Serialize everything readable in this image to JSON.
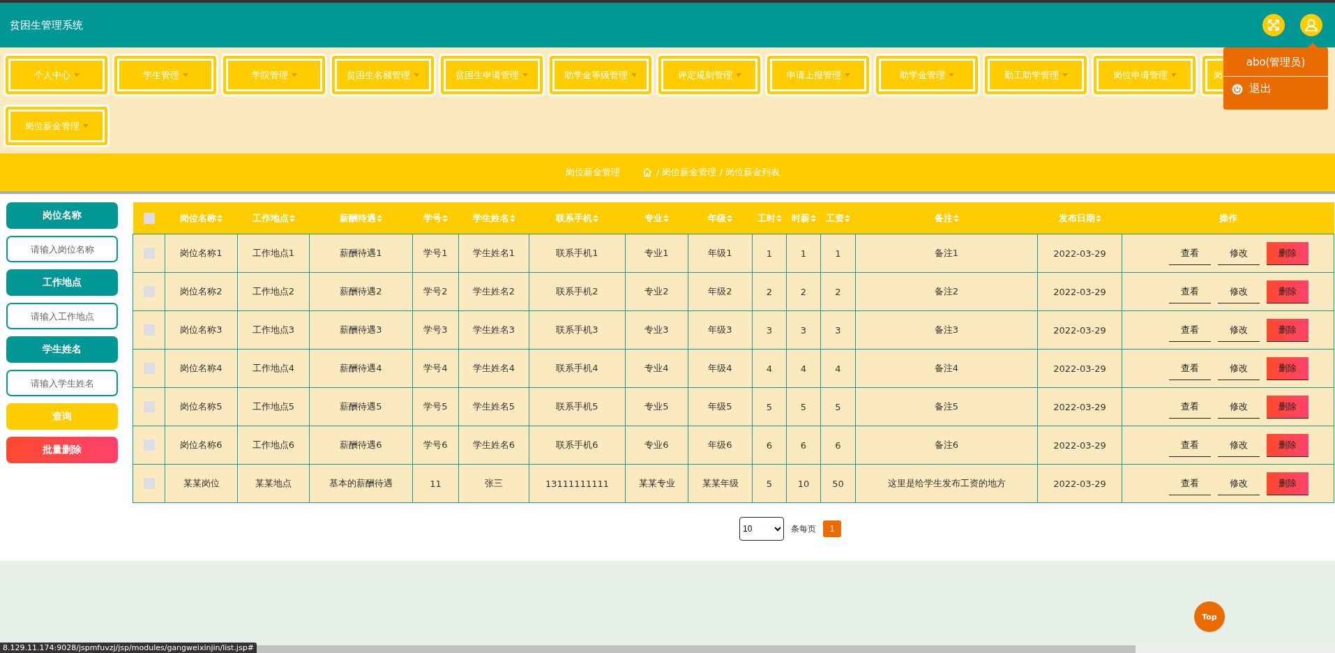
{
  "header": {
    "title": "贫困生管理系统"
  },
  "user_menu": {
    "user": "abo(管理员)",
    "logout": "退出"
  },
  "nav": [
    {
      "label": "个人中心",
      "cut": false
    },
    {
      "label": "学生管理",
      "cut": false
    },
    {
      "label": "学院管理",
      "cut": false
    },
    {
      "label": "贫困生名额管理",
      "cut": false
    },
    {
      "label": "贫困生申请管理",
      "cut": false
    },
    {
      "label": "助学金等级管理",
      "cut": false
    },
    {
      "label": "评定规则管理",
      "cut": false
    },
    {
      "label": "申请上报管理",
      "cut": false
    },
    {
      "label": "助学金管理",
      "cut": false
    },
    {
      "label": "勤工助学管理",
      "cut": false
    },
    {
      "label": "岗位申请管理",
      "cut": false
    },
    {
      "label": "岗",
      "cut": true
    },
    {
      "label": "岗位薪金管理",
      "cut": false
    }
  ],
  "breadcrumb": {
    "title": "岗位薪金管理",
    "path": "/ 岗位薪金管理 / 岗位薪金列表"
  },
  "filters": [
    {
      "label": "岗位名称",
      "placeholder": "请输入岗位名称"
    },
    {
      "label": "工作地点",
      "placeholder": "请输入工作地点"
    },
    {
      "label": "学生姓名",
      "placeholder": "请输入学生姓名"
    }
  ],
  "buttons": [
    {
      "label": "查询",
      "kind": "search"
    },
    {
      "label": "批量删除",
      "kind": "danger"
    }
  ],
  "table": {
    "select_all_checked": false,
    "columns": [
      {
        "label": "岗位名称",
        "sortable": true
      },
      {
        "label": "工作地点",
        "sortable": true
      },
      {
        "label": "薪酬待遇",
        "sortable": true
      },
      {
        "label": "学号",
        "sortable": true
      },
      {
        "label": "学生姓名",
        "sortable": true
      },
      {
        "label": "联系手机",
        "sortable": true
      },
      {
        "label": "专业",
        "sortable": true
      },
      {
        "label": "年级",
        "sortable": true
      },
      {
        "label": "工时",
        "sortable": true
      },
      {
        "label": "时薪",
        "sortable": true
      },
      {
        "label": "工资",
        "sortable": true
      },
      {
        "label": "备注",
        "sortable": true
      },
      {
        "label": "发布日期",
        "sortable": true
      },
      {
        "label": "操作",
        "sortable": false
      }
    ],
    "rows": [
      {
        "checked": false,
        "cells": [
          "岗位名称1",
          "工作地点1",
          "薪酬待遇1",
          "学号1",
          "学生姓名1",
          "联系手机1",
          "专业1",
          "年级1",
          "1",
          "1",
          "1",
          "备注1",
          "2022-03-29"
        ],
        "actions": [
          {
            "label": "查看",
            "kind": "view"
          },
          {
            "label": "修改",
            "kind": "edit"
          },
          {
            "label": "删除",
            "kind": "delete"
          }
        ]
      },
      {
        "checked": false,
        "cells": [
          "岗位名称2",
          "工作地点2",
          "薪酬待遇2",
          "学号2",
          "学生姓名2",
          "联系手机2",
          "专业2",
          "年级2",
          "2",
          "2",
          "2",
          "备注2",
          "2022-03-29"
        ],
        "actions": [
          {
            "label": "查看",
            "kind": "view"
          },
          {
            "label": "修改",
            "kind": "edit"
          },
          {
            "label": "删除",
            "kind": "delete"
          }
        ]
      },
      {
        "checked": false,
        "cells": [
          "岗位名称3",
          "工作地点3",
          "薪酬待遇3",
          "学号3",
          "学生姓名3",
          "联系手机3",
          "专业3",
          "年级3",
          "3",
          "3",
          "3",
          "备注3",
          "2022-03-29"
        ],
        "actions": [
          {
            "label": "查看",
            "kind": "view"
          },
          {
            "label": "修改",
            "kind": "edit"
          },
          {
            "label": "删除",
            "kind": "delete"
          }
        ]
      },
      {
        "checked": false,
        "cells": [
          "岗位名称4",
          "工作地点4",
          "薪酬待遇4",
          "学号4",
          "学生姓名4",
          "联系手机4",
          "专业4",
          "年级4",
          "4",
          "4",
          "4",
          "备注4",
          "2022-03-29"
        ],
        "actions": [
          {
            "label": "查看",
            "kind": "view"
          },
          {
            "label": "修改",
            "kind": "edit"
          },
          {
            "label": "删除",
            "kind": "delete"
          }
        ]
      },
      {
        "checked": false,
        "cells": [
          "岗位名称5",
          "工作地点5",
          "薪酬待遇5",
          "学号5",
          "学生姓名5",
          "联系手机5",
          "专业5",
          "年级5",
          "5",
          "5",
          "5",
          "备注5",
          "2022-03-29"
        ],
        "actions": [
          {
            "label": "查看",
            "kind": "view"
          },
          {
            "label": "修改",
            "kind": "edit"
          },
          {
            "label": "删除",
            "kind": "delete"
          }
        ]
      },
      {
        "checked": false,
        "cells": [
          "岗位名称6",
          "工作地点6",
          "薪酬待遇6",
          "学号6",
          "学生姓名6",
          "联系手机6",
          "专业6",
          "年级6",
          "6",
          "6",
          "6",
          "备注6",
          "2022-03-29"
        ],
        "actions": [
          {
            "label": "查看",
            "kind": "view"
          },
          {
            "label": "修改",
            "kind": "edit"
          },
          {
            "label": "删除",
            "kind": "delete"
          }
        ]
      },
      {
        "checked": false,
        "cells": [
          "某某岗位",
          "某某地点",
          "基本的薪酬待遇",
          "11",
          "张三",
          "13111111111",
          "某某专业",
          "某某年级",
          "5",
          "10",
          "50",
          "这里是给学生发布工资的地方",
          "2022-03-29"
        ],
        "actions": [
          {
            "label": "查看",
            "kind": "view"
          },
          {
            "label": "修改",
            "kind": "edit"
          },
          {
            "label": "删除",
            "kind": "delete"
          }
        ]
      }
    ]
  },
  "pagination": {
    "page_size": "10",
    "per_page_label": "条每页",
    "pages": [
      {
        "label": "1",
        "selected": true
      }
    ]
  },
  "back_to_top": "Top",
  "status_url": "8.129.11.174:9028/jspmfuvzj/jsp/modules/gangweixinjin/list.jsp#"
}
